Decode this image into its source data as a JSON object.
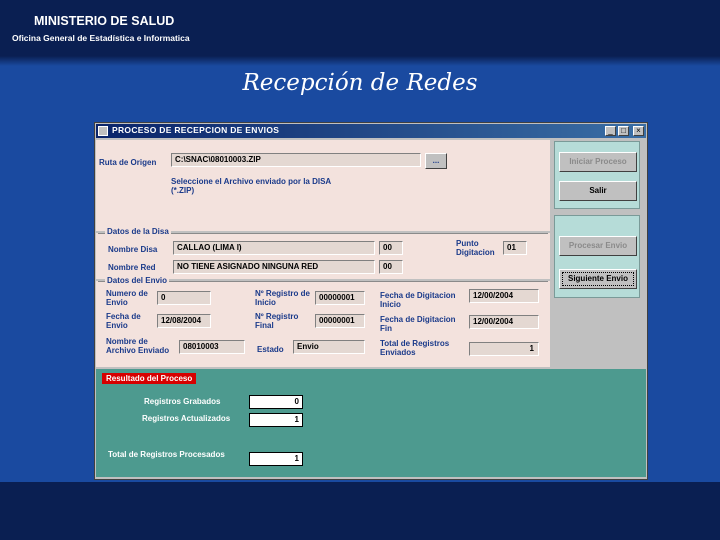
{
  "header": {
    "org_name": "MINISTERIO DE SALUD",
    "org_office": "Oficina General de Estadística e Informatica",
    "slide_title": "Recepción de Redes"
  },
  "window": {
    "title": "PROCESO DE RECEPCION DE ENVIOS",
    "controls": {
      "minimize": "_",
      "maximize": "□",
      "close": "×"
    }
  },
  "origen": {
    "label": "Ruta de Origen",
    "value": "C:\\SNAC\\08010003.ZIP",
    "browse_label": "...",
    "hint": "Seleccione el Archivo enviado por la DISA (*.ZIP)"
  },
  "disa": {
    "section": "Datos de la Disa",
    "nombre_disa_label": "Nombre Disa",
    "nombre_disa_value": "CALLAO (LIMA I)",
    "nombre_disa_code": "00",
    "nombre_red_label": "Nombre Red",
    "nombre_red_value": "NO TIENE ASIGNADO NINGUNA RED",
    "nombre_red_code": "00",
    "punto_digitacion_label": "Punto Digitacion",
    "punto_digitacion_value": "01"
  },
  "envio": {
    "section": "Datos del Envio",
    "numero_envio_label": "Numero de Envio",
    "numero_envio_value": "0",
    "fecha_envio_label": "Fecha de Envio",
    "fecha_envio_value": "12/08/2004",
    "nombre_archivo_label": "Nombre de Archivo Enviado",
    "nombre_archivo_value": "08010003",
    "registro_inicio_label": "Nº Registro de Inicio",
    "registro_inicio_value": "00000001",
    "registro_final_label": "Nº Registro Final",
    "registro_final_value": "00000001",
    "estado_label": "Estado",
    "estado_value": "Envio",
    "fecha_dig_inicio_label": "Fecha de Digitacion Inicio",
    "fecha_dig_inicio_value": "12/00/2004",
    "fecha_dig_fin_label": "Fecha de Digitacion Fin",
    "fecha_dig_fin_value": "12/00/2004",
    "total_enviados_label": "Total de Registros Enviados",
    "total_enviados_value": "1"
  },
  "actions": {
    "iniciar": "Iniciar Proceso",
    "salir": "Salir",
    "procesar": "Procesar Envio",
    "siguiente": "Siguiente Envio"
  },
  "resultado": {
    "section": "Resultado del Proceso",
    "grabados_label": "Registros Grabados",
    "grabados_value": "0",
    "actualizados_label": "Registros Actualizados",
    "actualizados_value": "1",
    "total_label": "Total de Registros Procesados",
    "total_value": "1"
  }
}
